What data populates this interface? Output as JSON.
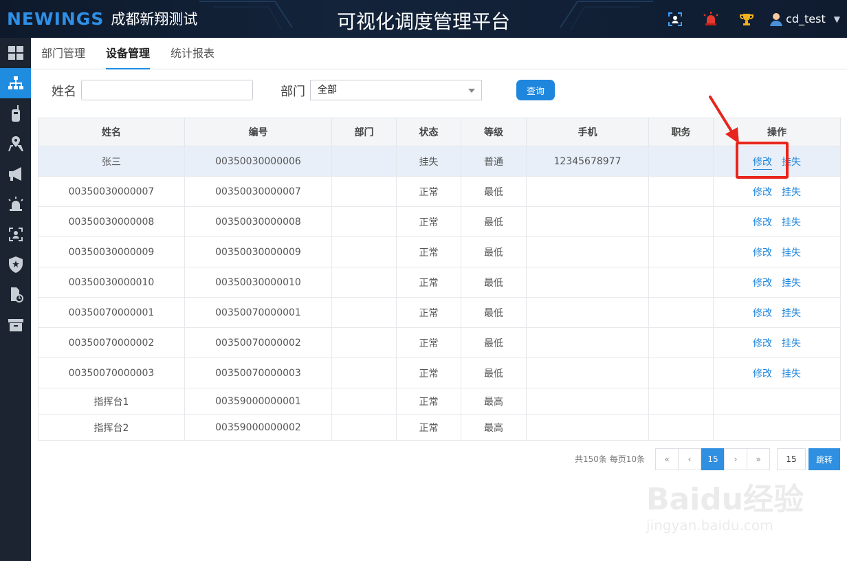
{
  "header": {
    "logo": "NEWINGS",
    "company": "成都新翔测试",
    "title": "可视化调度管理平台",
    "username": "cd_test",
    "icons": [
      "face-id-icon",
      "alarm-light-icon",
      "trophy-icon",
      "user-icon"
    ]
  },
  "sidebar": {
    "items": [
      "dashboard-icon",
      "org-chart-icon",
      "walkie-talkie-icon",
      "map-pin-icon",
      "megaphone-icon",
      "siren-icon",
      "face-frame-icon",
      "shield-icon",
      "device-clock-icon",
      "archive-icon"
    ],
    "active_index": 1
  },
  "tabs": [
    {
      "label": "部门管理",
      "active": false
    },
    {
      "label": "设备管理",
      "active": true
    },
    {
      "label": "统计报表",
      "active": false
    }
  ],
  "search": {
    "name_label": "姓名",
    "name_value": "",
    "dept_label": "部门",
    "dept_value": "全部",
    "query_button": "查询"
  },
  "table": {
    "headers": [
      "姓名",
      "编号",
      "部门",
      "状态",
      "等级",
      "手机",
      "职务",
      "操作"
    ],
    "rows": [
      {
        "name": "张三",
        "code": "00350030000006",
        "dept": "",
        "status": "挂失",
        "level": "普通",
        "phone": "12345678977",
        "title": "",
        "actions": [
          "修改",
          "挂失"
        ]
      },
      {
        "name": "00350030000007",
        "code": "00350030000007",
        "dept": "",
        "status": "正常",
        "level": "最低",
        "phone": "",
        "title": "",
        "actions": [
          "修改",
          "挂失"
        ]
      },
      {
        "name": "00350030000008",
        "code": "00350030000008",
        "dept": "",
        "status": "正常",
        "level": "最低",
        "phone": "",
        "title": "",
        "actions": [
          "修改",
          "挂失"
        ]
      },
      {
        "name": "00350030000009",
        "code": "00350030000009",
        "dept": "",
        "status": "正常",
        "level": "最低",
        "phone": "",
        "title": "",
        "actions": [
          "修改",
          "挂失"
        ]
      },
      {
        "name": "00350030000010",
        "code": "00350030000010",
        "dept": "",
        "status": "正常",
        "level": "最低",
        "phone": "",
        "title": "",
        "actions": [
          "修改",
          "挂失"
        ]
      },
      {
        "name": "00350070000001",
        "code": "00350070000001",
        "dept": "",
        "status": "正常",
        "level": "最低",
        "phone": "",
        "title": "",
        "actions": [
          "修改",
          "挂失"
        ]
      },
      {
        "name": "00350070000002",
        "code": "00350070000002",
        "dept": "",
        "status": "正常",
        "level": "最低",
        "phone": "",
        "title": "",
        "actions": [
          "修改",
          "挂失"
        ]
      },
      {
        "name": "00350070000003",
        "code": "00350070000003",
        "dept": "",
        "status": "正常",
        "level": "最低",
        "phone": "",
        "title": "",
        "actions": [
          "修改",
          "挂失"
        ]
      },
      {
        "name": "指挥台1",
        "code": "00359000000001",
        "dept": "",
        "status": "正常",
        "level": "最高",
        "phone": "",
        "title": "",
        "actions": []
      },
      {
        "name": "指挥台2",
        "code": "00359000000002",
        "dept": "",
        "status": "正常",
        "level": "最高",
        "phone": "",
        "title": "",
        "actions": []
      }
    ]
  },
  "pagination": {
    "info": "共150条 每页10条",
    "first": "«",
    "prev": "‹",
    "current": "15",
    "next": "›",
    "last": "»",
    "jump_value": "15",
    "jump_button": "跳转"
  },
  "watermark": {
    "main": "Baidu经验",
    "sub": "jingyan.baidu.com"
  },
  "colors": {
    "accent": "#1f8ce0",
    "header_bg": "#0f1c30",
    "sidebar_bg": "#1b2430",
    "link": "#1f86dd",
    "annotation": "#e8251d"
  }
}
